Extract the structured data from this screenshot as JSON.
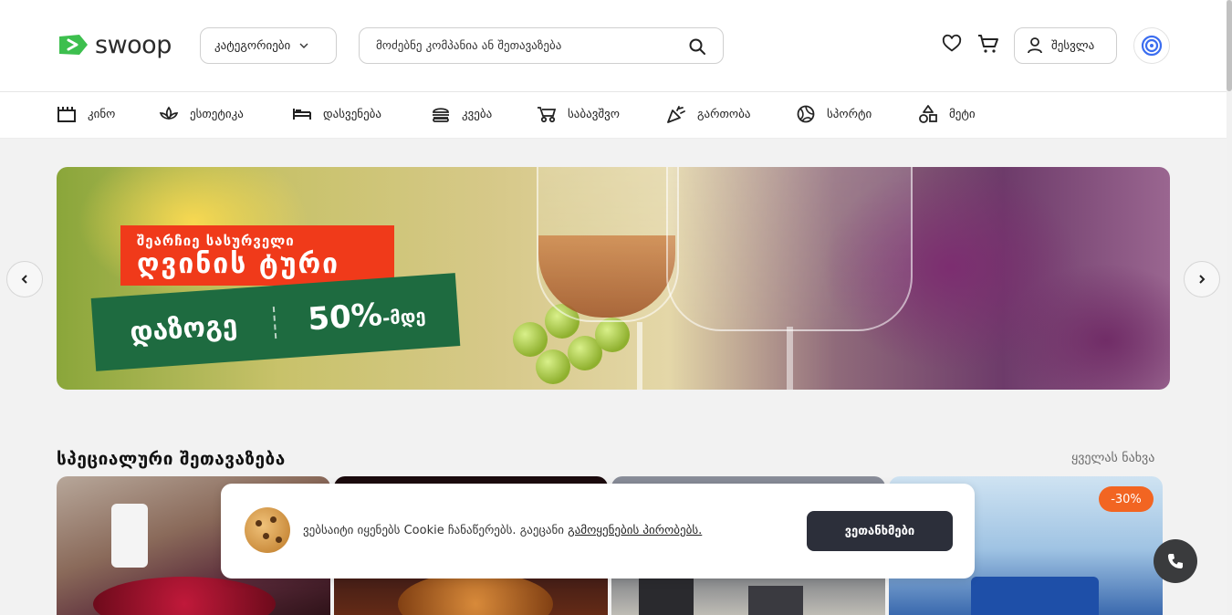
{
  "header": {
    "logo_text": "swoop",
    "categories_button": "კატეგორიები",
    "search_placeholder": "მოძებნე კომპანია ან შეთავაზება",
    "login_label": "შესვლა"
  },
  "categories": [
    {
      "label": "კინო",
      "icon": "cinema-icon"
    },
    {
      "label": "ესთეტიკა",
      "icon": "lotus-icon"
    },
    {
      "label": "დასვენება",
      "icon": "bed-icon"
    },
    {
      "label": "კვება",
      "icon": "burger-icon"
    },
    {
      "label": "საბავშვო",
      "icon": "stroller-icon"
    },
    {
      "label": "გართობა",
      "icon": "party-popper-icon"
    },
    {
      "label": "სპორტი",
      "icon": "ball-icon"
    },
    {
      "label": "მეტი",
      "icon": "shapes-icon"
    }
  ],
  "banner": {
    "line1": "შეარჩიე სასურველი",
    "line2": "ღვინის ტური",
    "save": "დაზოგე",
    "percent": "50%",
    "percent_suffix": "-მდე"
  },
  "section": {
    "title": "სპეციალური შეთავაზება",
    "see_all": "ყველას ნახვა",
    "discount": "-30%"
  },
  "cookie": {
    "text": "ვებსაიტი იყენებს Cookie ჩანაწერებს. გაეცანი ",
    "link": "გამოყენების პირობებს.",
    "button": "ვეთანხმები"
  },
  "colors": {
    "brand_green": "#3dbf4e",
    "promo_red": "#f03a1a",
    "promo_green": "#1e6b40",
    "discount_orange": "#f26522",
    "dark_button": "#2c2f3a"
  }
}
